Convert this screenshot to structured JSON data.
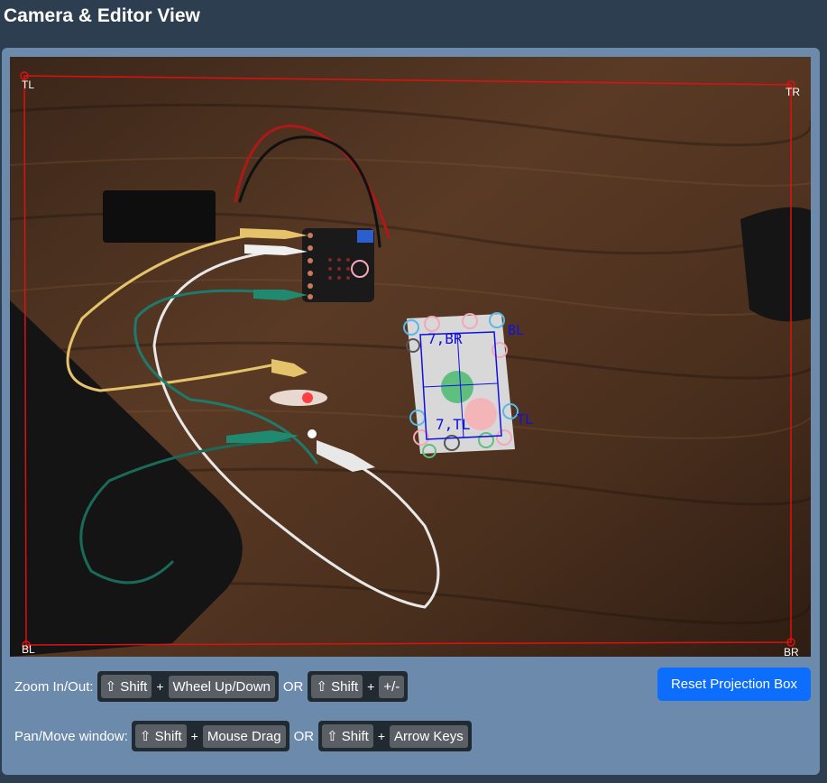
{
  "page": {
    "title": "Camera & Editor View"
  },
  "projection": {
    "corners": {
      "tl": "TL",
      "tr": "TR",
      "bl": "BL",
      "br": "BR"
    }
  },
  "marker_labels": {
    "top": "7,BR",
    "bottom": "7,TL",
    "right_top": "BL",
    "right_bottom": "TL"
  },
  "controls": {
    "zoom": {
      "label": "Zoom In/Out:",
      "combo1": {
        "modifier": "⇧ Shift",
        "plus": "+",
        "action": "Wheel Up/Down"
      },
      "or": "OR",
      "combo2": {
        "modifier": "⇧ Shift",
        "plus": "+",
        "action": "+/-"
      }
    },
    "pan": {
      "label": "Pan/Move window:",
      "combo1": {
        "modifier": "⇧ Shift",
        "plus": "+",
        "action": "Mouse Drag"
      },
      "or": "OR",
      "combo2": {
        "modifier": "⇧ Shift",
        "plus": "+",
        "action": "Arrow Keys"
      }
    },
    "reset_button": "Reset Projection Box"
  },
  "colors": {
    "background": "#2c3e50",
    "panel": "#6c8aab",
    "primary_button": "#0d6efd",
    "projection_line": "#e01010",
    "marker_box": "#1010e0"
  }
}
